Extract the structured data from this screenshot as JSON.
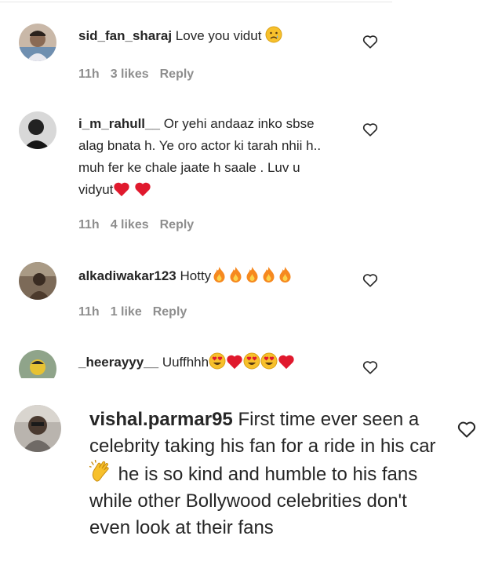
{
  "comments": [
    {
      "username": "sid_fan_sharaj",
      "text": "Love you vidut",
      "emoji": [
        "worried-face"
      ],
      "time": "11h",
      "likes": "3 likes",
      "reply": "Reply"
    },
    {
      "username": "i_m_rahull__",
      "text": "Or yehi andaaz inko sbse alag bnata h. Ye oro actor ki tarah nhii h.. muh fer ke chale jaate h saale . Luv u vidyut",
      "emoji": [
        "red-heart",
        "red-heart"
      ],
      "time": "11h",
      "likes": "4 likes",
      "reply": "Reply"
    },
    {
      "username": "alkadiwakar123",
      "text": "Hotty",
      "emoji": [
        "fire",
        "fire",
        "fire",
        "fire",
        "fire"
      ],
      "time": "11h",
      "likes": "1 like",
      "reply": "Reply"
    },
    {
      "username": "_heerayyy__",
      "text": "Uuffhhh",
      "emoji": [
        "heart-eyes",
        "red-heart",
        "heart-eyes",
        "heart-eyes",
        "red-heart"
      ]
    },
    {
      "username": "vishal.parmar95",
      "text_before": "First time ever seen a celebrity taking his fan for a ride in his car",
      "emoji": [
        "clapping-hands"
      ],
      "text_after": "he is so kind and humble to his fans while other Bollywood celebrities don't even look at their fans"
    }
  ],
  "icons": {
    "like": "heart-outline-icon"
  },
  "colors": {
    "text": "#262626",
    "meta": "#8e8e8e",
    "heart_red": "#e0192d",
    "fire": "#f6891f",
    "emoji_yellow": "#f7c02b"
  }
}
